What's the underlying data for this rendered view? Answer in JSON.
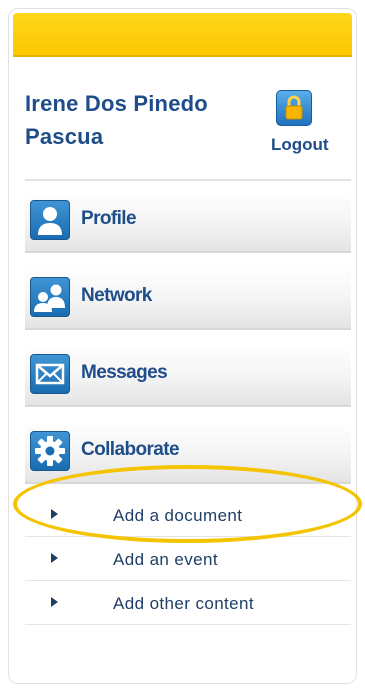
{
  "user": {
    "name": "Irene Dos Pinedo Pascua",
    "logout_label": "Logout",
    "logout_icon": "padlock-icon"
  },
  "nav": {
    "items": [
      {
        "label": "Profile",
        "icon": "person-icon"
      },
      {
        "label": "Network",
        "icon": "people-icon"
      },
      {
        "label": "Messages",
        "icon": "envelope-icon"
      },
      {
        "label": "Collaborate",
        "icon": "gear-icon"
      }
    ]
  },
  "collaborate_menu": {
    "items": [
      {
        "label": "Add a document"
      },
      {
        "label": "Add an event"
      },
      {
        "label": "Add other content"
      }
    ]
  },
  "colors": {
    "header_yellow": "#fcc800",
    "link_blue": "#1f4d8a",
    "icon_blue": "#1a6cb0",
    "highlight_yellow": "#f4c400"
  }
}
